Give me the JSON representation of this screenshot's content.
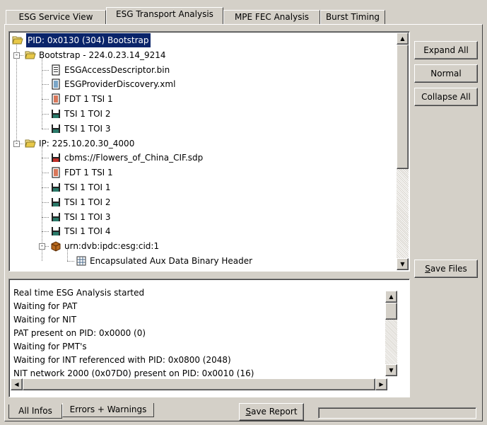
{
  "tabs": [
    {
      "label": "ESG Service View"
    },
    {
      "label": "ESG Transport Analysis"
    },
    {
      "label": "MPE FEC Analysis"
    },
    {
      "label": "Burst Timing"
    }
  ],
  "tree": [
    {
      "label": "PID: 0x0130 (304) Bootstrap",
      "icon": "open-folder-icon",
      "selected": true
    },
    {
      "label": "Bootstrap - 224.0.23.14_9214",
      "icon": "open-folder-icon"
    },
    {
      "label": "ESGAccessDescriptor.bin",
      "icon": "binary-file-icon"
    },
    {
      "label": "ESGProviderDiscovery.xml",
      "icon": "xml-file-icon"
    },
    {
      "label": "FDT 1 TSI 1",
      "icon": "fdt-file-icon"
    },
    {
      "label": "TSI 1 TOI 2",
      "icon": "floppy-icon"
    },
    {
      "label": "TSI 1 TOI 3",
      "icon": "floppy-icon"
    },
    {
      "label": "IP: 225.10.20.30_4000",
      "icon": "open-folder-icon"
    },
    {
      "label": "cbms://Flowers_of_China_CIF.sdp",
      "icon": "sdp-file-icon"
    },
    {
      "label": "FDT 1 TSI 1",
      "icon": "fdt-file-icon"
    },
    {
      "label": "TSI 1 TOI 1",
      "icon": "floppy-icon"
    },
    {
      "label": "TSI 1 TOI 2",
      "icon": "floppy-icon"
    },
    {
      "label": "TSI 1 TOI 3",
      "icon": "floppy-icon"
    },
    {
      "label": "TSI 1 TOI 4",
      "icon": "floppy-icon"
    },
    {
      "label": "urn:dvb:ipdc:esg:cid:1",
      "icon": "package-icon"
    },
    {
      "label": "Encapsulated Aux Data Binary Header",
      "icon": "table-icon"
    }
  ],
  "buttons": {
    "expand_all": "Expand All",
    "normal": "Normal",
    "collapse_all": "Collapse All",
    "save_files": "Save Files",
    "save_report": "Save Report"
  },
  "log": [
    "Real time ESG Analysis started",
    "Waiting for PAT",
    "Waiting for NIT",
    "PAT present on PID: 0x0000 (0)",
    "Waiting for PMT's",
    "Waiting for INT referenced with PID: 0x0800 (2048)",
    "NIT network 2000 (0x07D0) present on PID: 0x0010 (16)"
  ],
  "bottom_tabs": [
    {
      "label": "All Infos"
    },
    {
      "label": "Errors + Warnings"
    }
  ],
  "colors": {
    "selection": "#0a246a",
    "face": "#d4d0c8"
  }
}
